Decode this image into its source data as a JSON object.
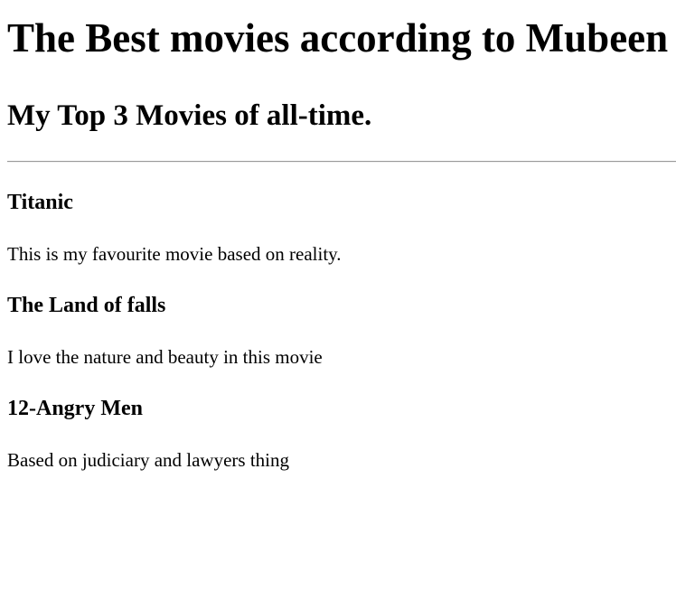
{
  "page": {
    "title": "The Best movies according to Mubeen",
    "subtitle": "My Top 3 Movies of all-time."
  },
  "movies": [
    {
      "title": "Titanic",
      "description": "This is my favourite movie based on reality."
    },
    {
      "title": "The Land of falls",
      "description": "I love the nature and beauty in this movie"
    },
    {
      "title": "12-Angry Men",
      "description": "Based on judiciary and lawyers thing"
    }
  ]
}
